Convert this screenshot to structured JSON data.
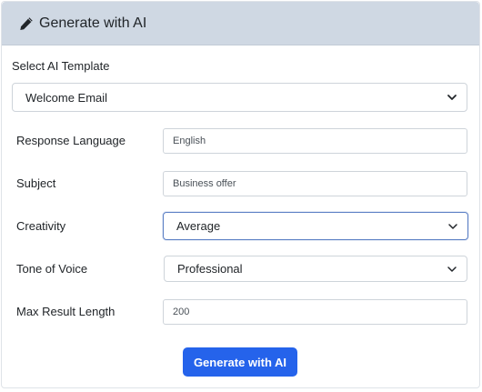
{
  "header": {
    "title": "Generate with AI",
    "icon": "pencil-icon"
  },
  "template": {
    "label": "Select AI Template",
    "value": "Welcome Email"
  },
  "fields": {
    "language": {
      "label": "Response Language",
      "value": "English"
    },
    "subject": {
      "label": "Subject",
      "value": "Business offer"
    },
    "creativity": {
      "label": "Creativity",
      "value": "Average"
    },
    "tone": {
      "label": "Tone of Voice",
      "value": "Professional"
    },
    "max_length": {
      "label": "Max Result Length",
      "value": "200"
    }
  },
  "actions": {
    "generate_label": "Generate with AI"
  },
  "colors": {
    "header_bg": "#cfd8e3",
    "button_bg": "#2563eb",
    "focus_border": "#5b7fc5"
  }
}
